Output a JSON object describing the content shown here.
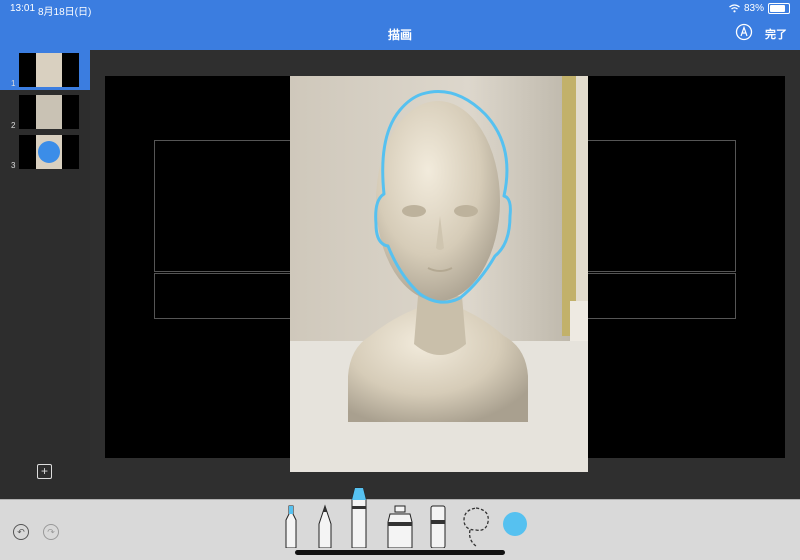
{
  "status_bar": {
    "time": "13:01",
    "date": "8月18日(日)",
    "battery": "83%"
  },
  "header": {
    "title": "描画",
    "done_label": "完了"
  },
  "sidebar": {
    "slides": [
      {
        "number": "1",
        "selected": true
      },
      {
        "number": "2",
        "selected": false
      },
      {
        "number": "3",
        "selected": false
      }
    ],
    "add_button": "+"
  },
  "toolbar": {
    "undo_icon": "undo-icon",
    "redo_icon": "redo-icon",
    "tools": [
      "pen",
      "pencil",
      "crayon",
      "fill",
      "eraser",
      "lasso"
    ],
    "selected_tool": "crayon",
    "color": "#56c1f0"
  },
  "colors": {
    "accent": "#3b7de0",
    "stroke": "#56c1f0"
  }
}
